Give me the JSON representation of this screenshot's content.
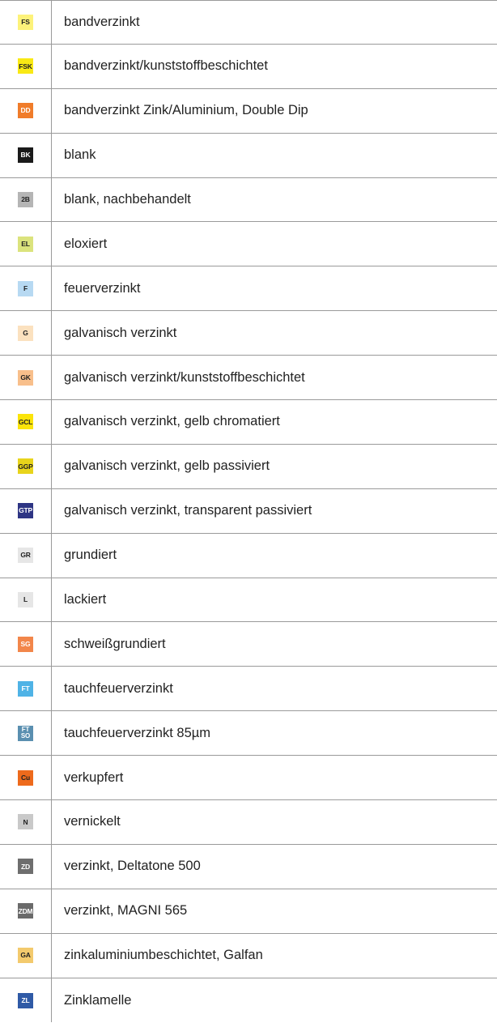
{
  "rows": [
    {
      "code": "FS",
      "description": "bandverzinkt",
      "badge_bg": "#fdf27a",
      "badge_fg": "#222222"
    },
    {
      "code": "FSK",
      "description": "bandverzinkt/kunststoffbeschichtet",
      "badge_bg": "#f9e914",
      "badge_fg": "#222222"
    },
    {
      "code": "DD",
      "description": "bandverzinkt Zink/Aluminium, Double Dip",
      "badge_bg": "#f07c2a",
      "badge_fg": "#ffffff"
    },
    {
      "code": "BK",
      "description": "blank",
      "badge_bg": "#1a1a1a",
      "badge_fg": "#ffffff"
    },
    {
      "code": "2B",
      "description": "blank, nachbehandelt",
      "badge_bg": "#b5b5b5",
      "badge_fg": "#222222"
    },
    {
      "code": "EL",
      "description": "eloxiert",
      "badge_bg": "#dbe37d",
      "badge_fg": "#222222"
    },
    {
      "code": "F",
      "description": "feuerverzinkt",
      "badge_bg": "#b7d9f2",
      "badge_fg": "#222222"
    },
    {
      "code": "G",
      "description": "galvanisch verzinkt",
      "badge_bg": "#fbe1bf",
      "badge_fg": "#222222"
    },
    {
      "code": "GK",
      "description": "galvanisch verzinkt/kunststoffbeschichtet",
      "badge_bg": "#f8bf8b",
      "badge_fg": "#222222"
    },
    {
      "code": "GCL",
      "description": "galvanisch verzinkt, gelb chromatiert",
      "badge_bg": "#fbe40a",
      "badge_fg": "#222222"
    },
    {
      "code": "GGP",
      "description": "galvanisch verzinkt, gelb passiviert",
      "badge_bg": "#e8d41b",
      "badge_fg": "#222222"
    },
    {
      "code": "GTP",
      "description": "galvanisch verzinkt, transparent passiviert",
      "badge_bg": "#2e3584",
      "badge_fg": "#ffffff"
    },
    {
      "code": "GR",
      "description": "grundiert",
      "badge_bg": "#e6e6e6",
      "badge_fg": "#222222"
    },
    {
      "code": "L",
      "description": "lackiert",
      "badge_bg": "#e6e6e6",
      "badge_fg": "#222222"
    },
    {
      "code": "SG",
      "description": "schweißgrundiert",
      "badge_bg": "#f2864a",
      "badge_fg": "#ffffff"
    },
    {
      "code": "FT",
      "description": "tauchfeuerverzinkt",
      "badge_bg": "#4fb3e6",
      "badge_fg": "#ffffff"
    },
    {
      "code": "FT\nSO",
      "description": "tauchfeuerverzinkt 85µm",
      "badge_bg": "#5a8fb0",
      "badge_fg": "#ffffff"
    },
    {
      "code": "Cu",
      "description": "verkupfert",
      "badge_bg": "#ee6a1c",
      "badge_fg": "#222222"
    },
    {
      "code": "N",
      "description": "vernickelt",
      "badge_bg": "#c9c9c9",
      "badge_fg": "#222222"
    },
    {
      "code": "ZD",
      "description": "verzinkt, Deltatone 500",
      "badge_bg": "#6e6e6e",
      "badge_fg": "#ffffff"
    },
    {
      "code": "ZDM",
      "description": "verzinkt, MAGNI 565",
      "badge_bg": "#6a6a6a",
      "badge_fg": "#ffffff"
    },
    {
      "code": "GA",
      "description": "zinkaluminiumbeschichtet, Galfan",
      "badge_bg": "#f3ca6d",
      "badge_fg": "#222222"
    },
    {
      "code": "ZL",
      "description": "Zinklamelle",
      "badge_bg": "#2f5aa6",
      "badge_fg": "#ffffff"
    }
  ]
}
